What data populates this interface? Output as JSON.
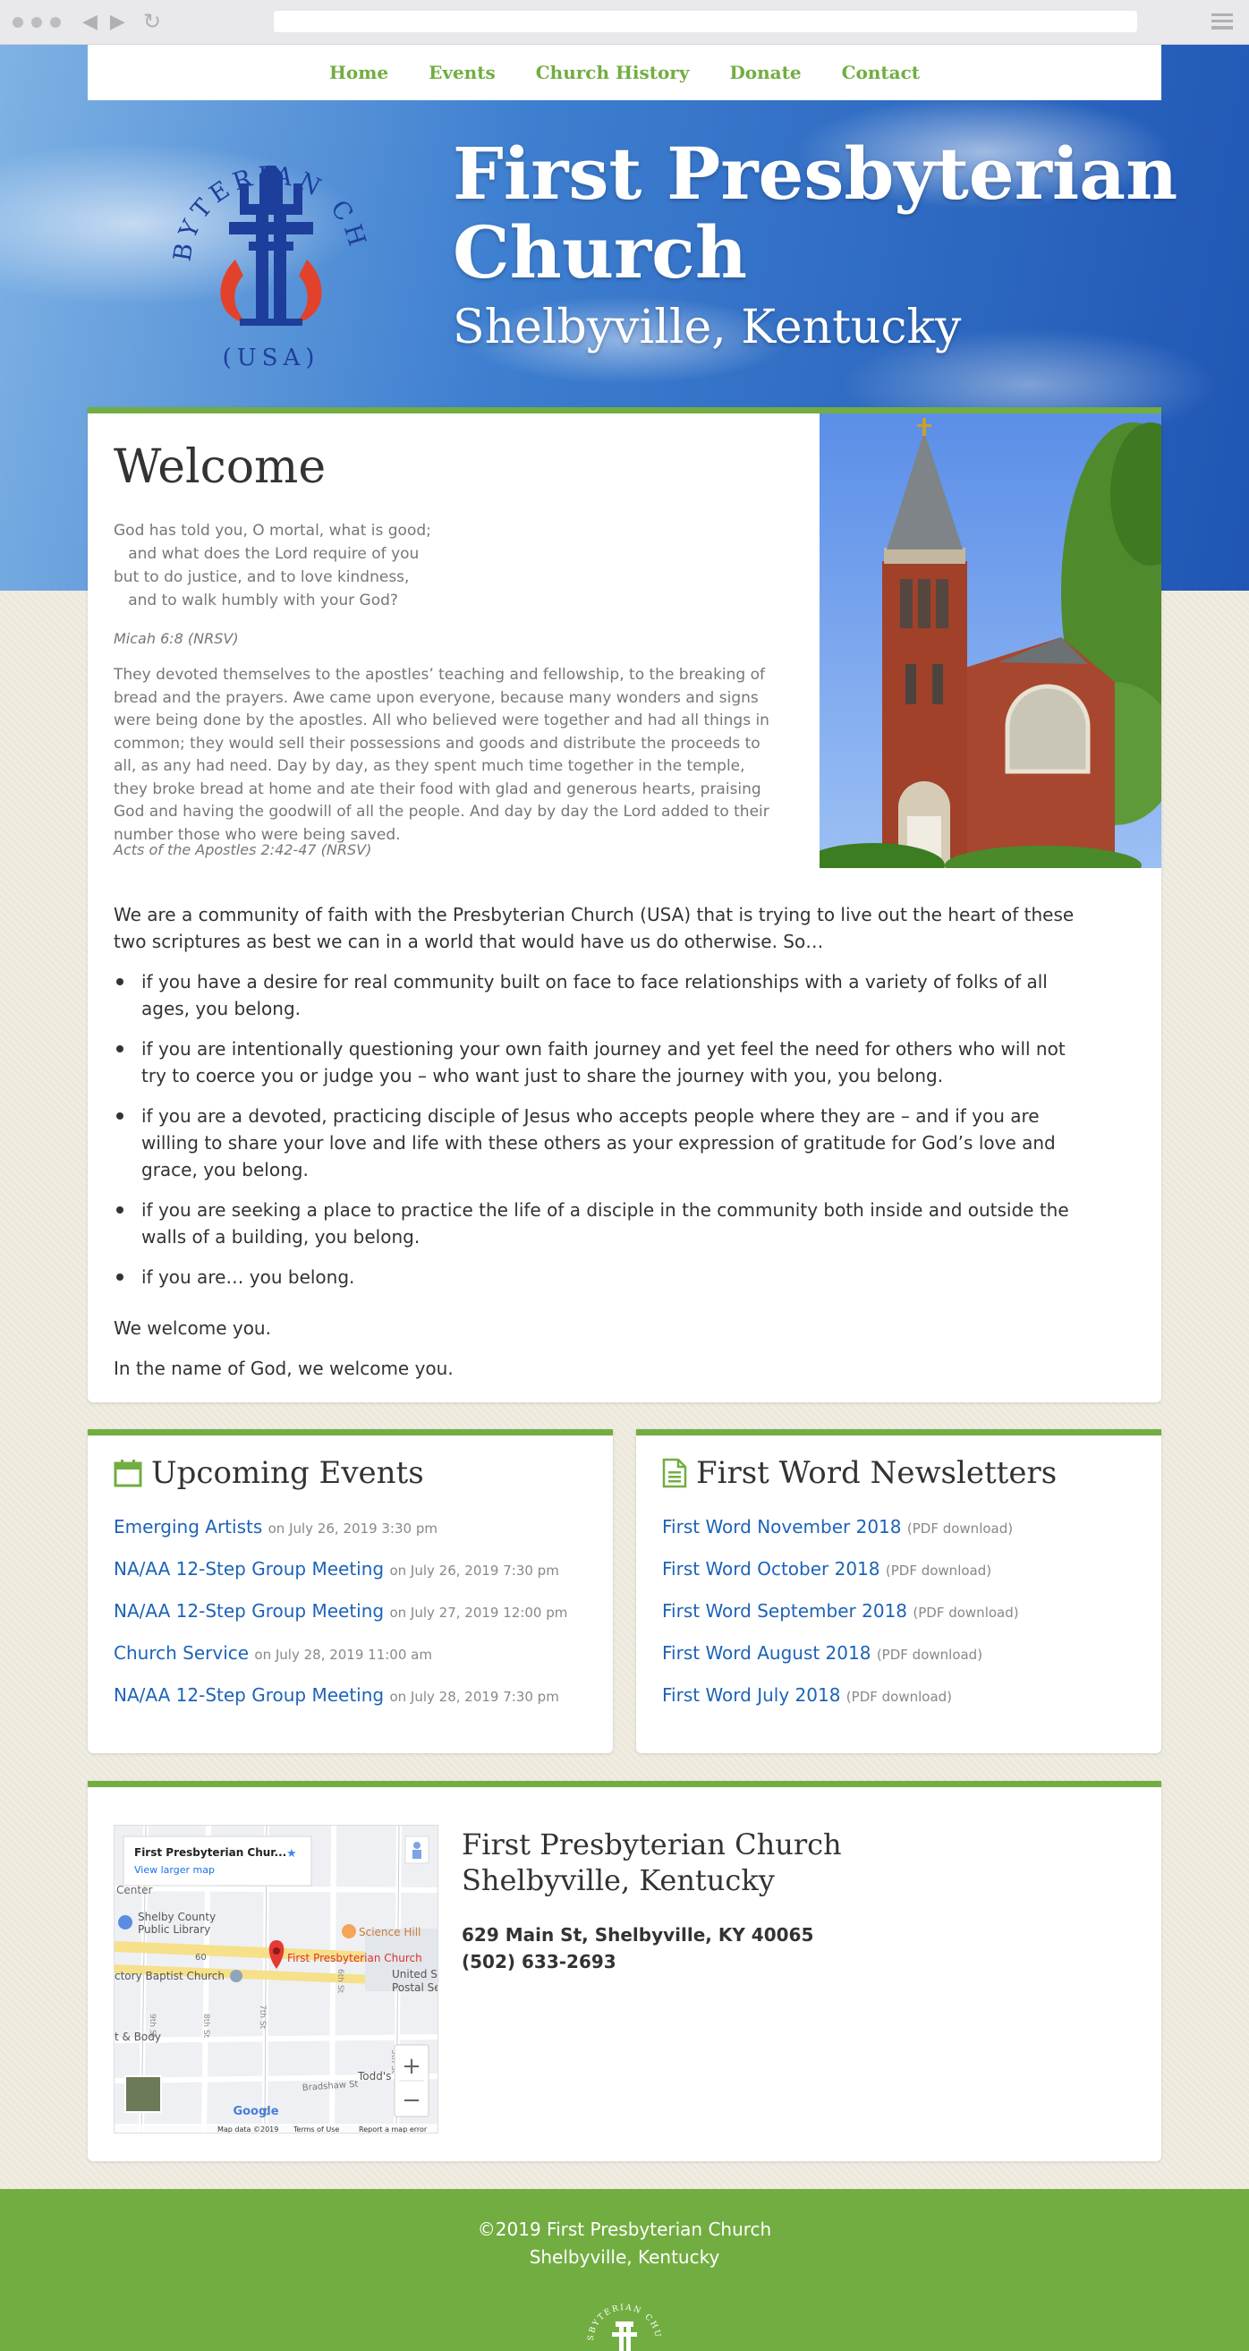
{
  "nav": {
    "items": [
      {
        "label": "Home"
      },
      {
        "label": "Events"
      },
      {
        "label": "Church History"
      },
      {
        "label": "Donate"
      },
      {
        "label": "Contact"
      }
    ]
  },
  "header": {
    "logo_ring_text": "PRESBYTERIAN CHURCH",
    "logo_bottom_text": "(USA)",
    "title": "First Presbyterian Church",
    "subtitle": "Shelbyville, Kentucky"
  },
  "welcome": {
    "heading": "Welcome",
    "verse_lines": [
      "God has told you, O mortal, what is good;",
      "   and what does the Lord require of you",
      "but to do justice, and to love kindness,",
      "   and to walk humbly with your God?"
    ],
    "verse_cite": "Micah 6:8 (NRSV)",
    "acts_text": "They devoted themselves to the apostles’ teaching and fellowship, to the breaking of bread and the prayers. Awe came upon everyone, because many wonders and signs were being done by the apostles. All who believed were together and had all things in common; they would sell their possessions and goods and distribute the proceeds to all, as any had need. Day by day, as they spent much time together in the temple, they broke bread at home and ate their food with glad and generous hearts, praising God and having the goodwill of all the people. And day by day the Lord added to their number those who were being saved.",
    "acts_cite": "Acts of the Apostles 2:42-47 (NRSV)",
    "intro": "We are a community of faith with the Presbyterian Church (USA) that is trying to live out the heart of these two scriptures as best we can in a world that would have us do otherwise. So…",
    "bullets": [
      "if you have a desire for real community built on face to face relationships with a variety of folks of all ages, you belong.",
      "if you are intentionally questioning your own faith journey and yet feel the need for others who will not try to coerce you or judge you – who want just to share the journey with you, you belong.",
      "if you are a devoted, practicing disciple of Jesus who accepts people where they are – and if you are willing to share your love and life with these others as your expression of gratitude for God’s love and grace, you belong.",
      "if you are seeking a place to practice the life of a disciple in the community both inside and outside the walls of a building, you belong.",
      "if you are… you belong."
    ],
    "closing_1": "We welcome you.",
    "closing_2": "In the name of God, we welcome you."
  },
  "events": {
    "title": "Upcoming Events",
    "icon": "calendar-icon",
    "items": [
      {
        "name": "Emerging Artists",
        "when": "on July 26, 2019 3:30 pm"
      },
      {
        "name": "NA/AA 12-Step Group Meeting",
        "when": "on July 26, 2019 7:30 pm"
      },
      {
        "name": "NA/AA 12-Step Group Meeting",
        "when": "on July 27, 2019 12:00 pm"
      },
      {
        "name": "Church Service",
        "when": "on July 28, 2019 11:00 am"
      },
      {
        "name": "NA/AA 12-Step Group Meeting",
        "when": "on July 28, 2019 7:30 pm"
      }
    ]
  },
  "newsletters": {
    "title": "First Word Newsletters",
    "icon": "document-icon",
    "items": [
      {
        "name": "First Word November 2018",
        "note": "(PDF download)"
      },
      {
        "name": "First Word October 2018",
        "note": "(PDF download)"
      },
      {
        "name": "First Word September 2018",
        "note": "(PDF download)"
      },
      {
        "name": "First Word August 2018",
        "note": "(PDF download)"
      },
      {
        "name": "First Word July 2018",
        "note": "(PDF download)"
      }
    ]
  },
  "map": {
    "card_title": "First Presbyterian Chur...",
    "card_link": "View larger map",
    "labels": {
      "center": "Center",
      "library_1": "Shelby County",
      "library_2": "Public Library",
      "science": "Science Hill",
      "church": "First Presbyterian Church",
      "baptist": "ctory Baptist Church",
      "post_1": "United Sta",
      "post_2": "Postal Serv",
      "body": "t & Body",
      "todds": "Todd's",
      "bradshaw": "Bradshaw St",
      "route": "60",
      "st_9": "9th St",
      "st_8": "8th St",
      "st_7": "7th St",
      "st_6": "6th St",
      "st_5": "5th St",
      "st_bottom": "St"
    },
    "google": "Google",
    "zoom_in": "+",
    "zoom_out": "−",
    "footer_items": [
      "Map data ©2019",
      "Terms of Use",
      "Report a map error"
    ]
  },
  "location": {
    "title_1": "First Presbyterian Church",
    "title_2": "Shelbyville, Kentucky",
    "address": "629 Main St, Shelbyville, KY 40065",
    "phone": "(502) 633-2693"
  },
  "footer": {
    "copyright": "©2019 First Presbyterian Church",
    "place": "Shelbyville, Kentucky",
    "logo_text": "PRESBYTERIAN CHURCH"
  },
  "colors": {
    "accent": "#72ad41",
    "link": "#1d63b8",
    "logo_blue": "#1e3e9c",
    "logo_red": "#e2412b"
  }
}
